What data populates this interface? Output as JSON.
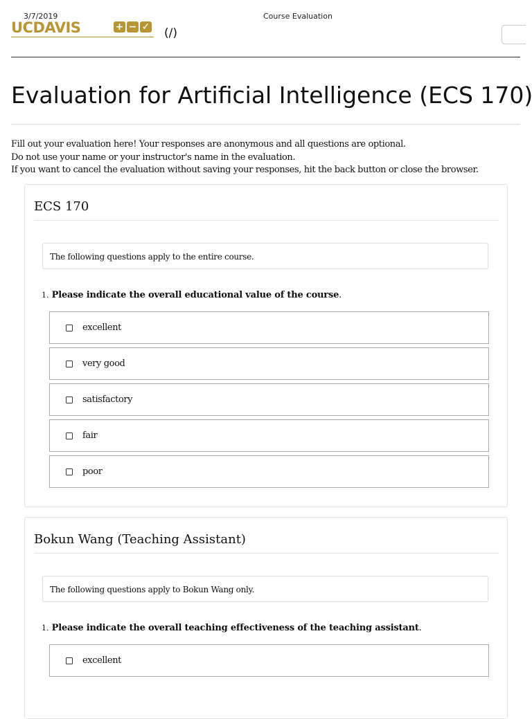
{
  "print_header": {
    "date": "3/7/2019",
    "title": "Course Evaluation"
  },
  "brand": {
    "logo_text": "UCDAVIS",
    "logo_icons": [
      "plus-icon",
      "minus-icon",
      "check-icon"
    ],
    "root_link": "(/)",
    "accent_color": "#b89534"
  },
  "page": {
    "title": "Evaluation for Artificial Intelligence (ECS 170)",
    "intro": [
      "Fill out your evaluation here! Your responses are anonymous and all questions are optional.",
      "Do not use your name or your instructor's name in the evaluation.",
      "If you want to cancel the evaluation without saving your responses, hit the back button or close the browser."
    ]
  },
  "sections": [
    {
      "heading": "ECS 170",
      "note": "The following questions apply to the entire course.",
      "question": {
        "number": "1.",
        "text": "Please indicate the overall educational value of the course",
        "suffix": "."
      },
      "options": [
        "excellent",
        "very good",
        "satisfactory",
        "fair",
        "poor"
      ]
    },
    {
      "heading": "Bokun Wang (Teaching Assistant)",
      "note": "The following questions apply to Bokun Wang only.",
      "question": {
        "number": "1.",
        "text": "Please indicate the overall teaching effectiveness of the teaching assistant",
        "suffix": "."
      },
      "options": [
        "excellent"
      ]
    }
  ]
}
